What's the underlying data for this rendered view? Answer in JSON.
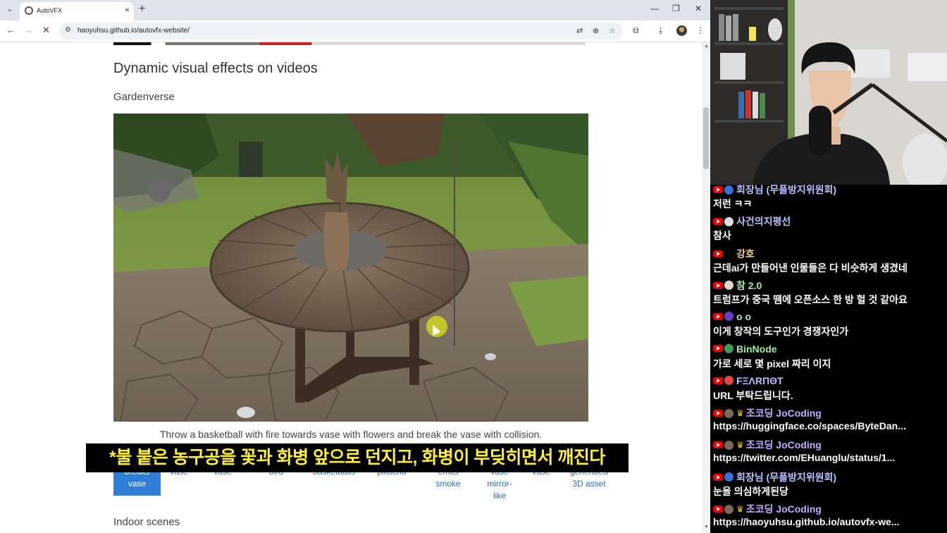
{
  "browser": {
    "tab": {
      "title": "AutoVFX"
    },
    "omnibox": {
      "url": "haoyuhsu.github.io/autovfx-website/"
    }
  },
  "page": {
    "section_title": "Dynamic visual effects on videos",
    "subsection_title": "Gardenverse",
    "caption": "Throw a basketball with fire towards vase with flowers and break the vase with collision.",
    "video_buttons": [
      {
        "line1": "breaks",
        "line2": "vase"
      },
      {
        "line1": "vase"
      },
      {
        "line1": "vase"
      },
      {
        "line1": "bird"
      },
      {
        "line1": "basketballs"
      },
      {
        "line1": "pikachu"
      },
      {
        "line1": "emits",
        "line2": "smoke"
      },
      {
        "line1": "vase",
        "line2": "mirror-",
        "line3": "like"
      },
      {
        "line1": "vase"
      },
      {
        "line1": "generated",
        "line2": "3D asset"
      }
    ],
    "next_subsection": "Indoor scenes"
  },
  "overlay_subtitle": "*불 붙은 농구공을 꽃과 화병 앞으로 던지고, 화병이 부딪히면서 깨진다",
  "chat": {
    "messages": [
      {
        "user": "회장님 (무플방지위원회)",
        "text": "저런 ㅋㅋ",
        "user_color": "#b6c4ff",
        "avatar": "#3a6fd8",
        "crown": false
      },
      {
        "user": "사건의지평선",
        "text": "참사",
        "user_color": "#b6c4ff",
        "avatar": "#dddddd",
        "crown": false
      },
      {
        "user": "강호",
        "text": "근데ai가 만들어낸 인물들은 다 비슷하게 생겼네",
        "user_color": "#f5d37a",
        "avatar": "#000000",
        "crown": false
      },
      {
        "user": "참 2.0",
        "text": "트럼프가 중국 땜에 오픈소스 한 방 헐 것 같아요",
        "user_color": "#9ef0a5",
        "avatar": "#e0d8c8",
        "crown": false
      },
      {
        "user": "o o",
        "text": "이게 창작의 도구인가 경쟁자인가",
        "user_color": "#9ef0a5",
        "avatar": "#6a3fc8",
        "crown": false
      },
      {
        "user": "BinNode",
        "text": "가로 세로 몇 pixel 짜리 이지",
        "user_color": "#9ef0a5",
        "avatar": "#3c9d5a",
        "crown": false
      },
      {
        "user": "FΞΛRΠΘT",
        "text": "URL 부탁드립니다.",
        "user_color": "#b6c4ff",
        "avatar": "#e24a4a",
        "crown": false
      },
      {
        "user": "조코딩 JoCoding",
        "text": "https://huggingface.co/spaces/ByteDan...",
        "user_color": "#c9a9ff",
        "avatar": "#7a6a55",
        "crown": true
      },
      {
        "user": "조코딩 JoCoding",
        "text": "https://twitter.com/EHuanglu/status/1...",
        "user_color": "#c9a9ff",
        "avatar": "#7a6a55",
        "crown": true
      },
      {
        "user": "회장님 (무플방지위원회)",
        "text": "눈을 의심하게된당",
        "user_color": "#b6c4ff",
        "avatar": "#3a6fd8",
        "crown": false
      },
      {
        "user": "조코딩 JoCoding",
        "text": "https://haoyuhsu.github.io/autovfx-we...",
        "user_color": "#c9a9ff",
        "avatar": "#7a6a55",
        "crown": true
      }
    ]
  }
}
